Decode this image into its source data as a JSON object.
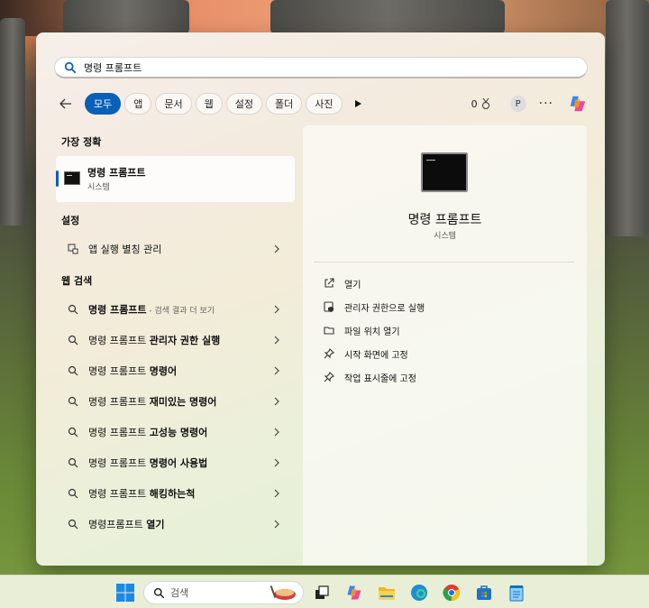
{
  "start_menu": {
    "search": {
      "query": "명령 프롬프트"
    },
    "filters": {
      "chips": [
        "모두",
        "앱",
        "문서",
        "웹",
        "설정",
        "폴더",
        "사진"
      ],
      "active_index": 0,
      "points": "0",
      "avatar_letter": "P"
    },
    "best_match": {
      "heading": "가장 정확",
      "name": "명령 프롬프트",
      "sub": "시스템"
    },
    "settings": {
      "heading": "설정",
      "items": [
        {
          "label": "앱 실행 별칭 관리"
        }
      ]
    },
    "web": {
      "heading": "웹 검색",
      "items": [
        {
          "prefix": "명령 프롬프트",
          "bold": "",
          "hint": " - 검색 결과 더 보기"
        },
        {
          "prefix": "명령 프롬프트 ",
          "bold": "관리자 권한 실행",
          "hint": ""
        },
        {
          "prefix": "명령 프롬프트 ",
          "bold": "명령어",
          "hint": ""
        },
        {
          "prefix": "명령 프롬프트 ",
          "bold": "재미있는 명령어",
          "hint": ""
        },
        {
          "prefix": "명령 프롬프트 ",
          "bold": "고성능 명령어",
          "hint": ""
        },
        {
          "prefix": "명령 프롬프트 ",
          "bold": "명령어 사용법",
          "hint": ""
        },
        {
          "prefix": "명령 프롬프트 ",
          "bold": "해킹하는척",
          "hint": ""
        },
        {
          "prefix": "명령프롬프트 ",
          "bold": "열기",
          "hint": ""
        }
      ]
    },
    "detail": {
      "title": "명령 프롬프트",
      "subtitle": "시스템",
      "actions": [
        {
          "label": "열기",
          "icon": "open-external-icon"
        },
        {
          "label": "관리자 권한으로 실행",
          "icon": "shield-admin-icon"
        },
        {
          "label": "파일 위치 열기",
          "icon": "folder-icon"
        },
        {
          "label": "시작 화면에 고정",
          "icon": "pin-icon"
        },
        {
          "label": "작업 표시줄에 고정",
          "icon": "pin-icon"
        }
      ]
    }
  },
  "taskbar": {
    "search_placeholder": "검색",
    "icons": [
      "start-icon",
      "task-view-icon",
      "copilot-icon",
      "file-explorer-icon",
      "edge-icon",
      "chrome-icon",
      "store-icon",
      "notepad-icon"
    ]
  },
  "colors": {
    "accent": "#0a5fb8"
  }
}
